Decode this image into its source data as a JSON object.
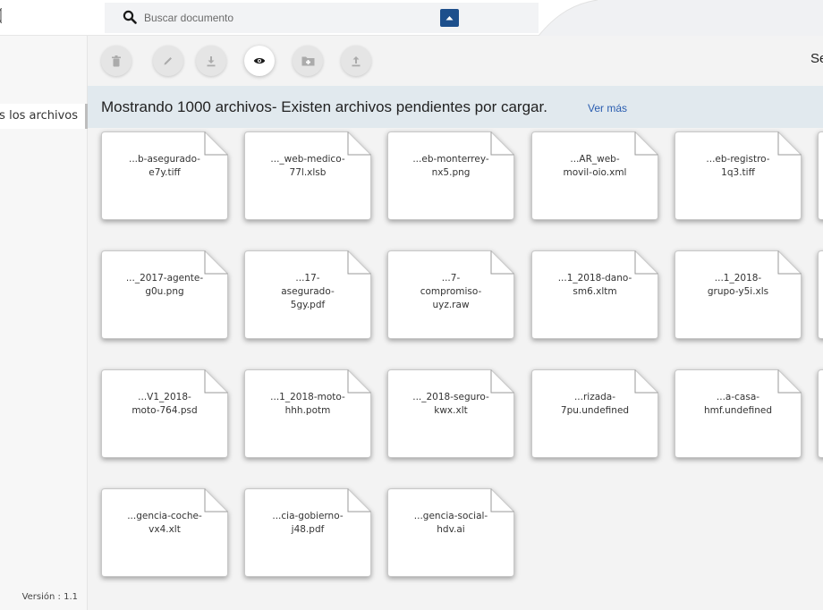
{
  "header": {
    "search_placeholder": "Buscar documento"
  },
  "sidebar": {
    "nav_item": "os los archivos",
    "version": "Versión : 1.1"
  },
  "toolbar": {
    "buttons": [
      {
        "name": "delete",
        "icon": "trash-icon"
      },
      {
        "name": "edit",
        "icon": "pencil-icon"
      },
      {
        "name": "download",
        "icon": "download-icon"
      },
      {
        "name": "view",
        "icon": "eye-icon"
      },
      {
        "name": "new-folder",
        "icon": "folder-plus-icon"
      },
      {
        "name": "upload",
        "icon": "upload-icon"
      }
    ],
    "right_text": "Se"
  },
  "banner": {
    "text": "Mostrando 1000 archivos- Existen archivos pendientes por cargar.",
    "link": "Ver más"
  },
  "files": [
    {
      "name": "...b-asegurado-\ne7y.tiff"
    },
    {
      "name": "..._web-medico-\n77l.xlsb"
    },
    {
      "name": "...eb-monterrey-\nnx5.png"
    },
    {
      "name": "...AR_web-\nmovil-oio.xml"
    },
    {
      "name": "...eb-registro-\n1q3.tiff"
    },
    {
      "name": ""
    },
    {
      "name": "..._2017-agente-\ng0u.png"
    },
    {
      "name": "...17-\nasegurado-\n5gy.pdf"
    },
    {
      "name": "...7-\ncompromiso-\nuyz.raw"
    },
    {
      "name": "...1_2018-dano-\nsm6.xltm"
    },
    {
      "name": "...1_2018-\ngrupo-y5i.xls"
    },
    {
      "name": ""
    },
    {
      "name": "...V1_2018-\nmoto-764.psd"
    },
    {
      "name": "...1_2018-moto-\nhhh.potm"
    },
    {
      "name": "..._2018-seguro-\nkwx.xlt"
    },
    {
      "name": "...rizada-\n7pu.undefined"
    },
    {
      "name": "...a-casa-\nhmf.undefined"
    },
    {
      "name": ""
    },
    {
      "name": "...gencia-coche-\nvx4.xlt"
    },
    {
      "name": "...cia-gobierno-\nj48.pdf"
    },
    {
      "name": "...gencia-social-\nhdv.ai"
    }
  ],
  "colors": {
    "accent": "#1d4f8c",
    "banner_bg": "#e1e9ee",
    "link": "#2a5db0",
    "toolbar_bg": "#f3f3f3"
  }
}
